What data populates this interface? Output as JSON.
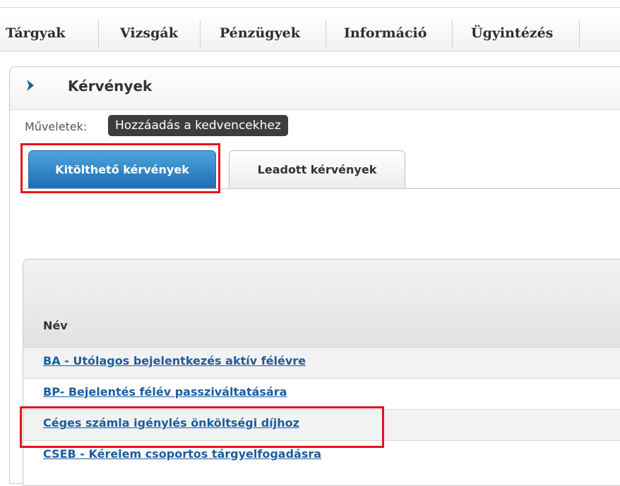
{
  "topnav": {
    "items": [
      {
        "label": "Tárgyak"
      },
      {
        "label": "Vizsgák"
      },
      {
        "label": "Pénzügyek"
      },
      {
        "label": "Információ"
      },
      {
        "label": "Ügyintézés"
      }
    ]
  },
  "panel": {
    "title": "Kérvények",
    "operations_label": "Műveletek:",
    "favorite_button": "Hozzáadás a kedvencekhez",
    "tabs": [
      {
        "label": "Kitölthető kérvények",
        "active": true
      },
      {
        "label": "Leadott kérvények",
        "active": false
      }
    ]
  },
  "table": {
    "column_name": "Név",
    "rows": [
      {
        "label": "BA - Utólagos bejelentkezés aktív félévre"
      },
      {
        "label": "BP- Bejelentés félév passziváltatására"
      },
      {
        "label": "Céges számla igénylés önköltségi díjhoz"
      },
      {
        "label": "CSEB - Kérelem csoportos tárgyelfogadásra"
      }
    ]
  },
  "colors": {
    "accent_blue": "#1b6fb5",
    "link": "#1c5d9e",
    "highlight": "#e3151b",
    "favorite_bg": "#3d3d3d"
  },
  "icons": {
    "panel_chevron": "chevron-right-icon"
  }
}
